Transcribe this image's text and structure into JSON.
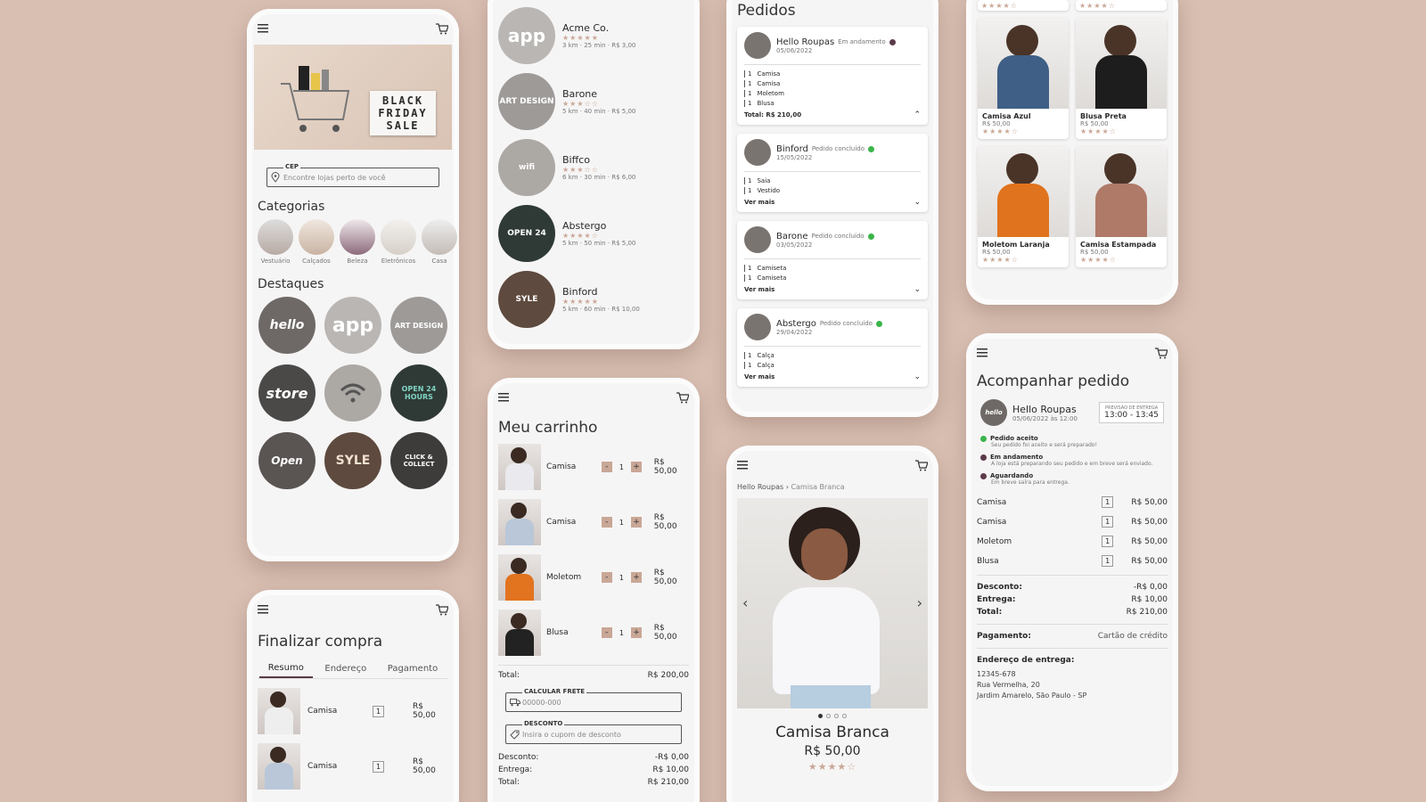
{
  "home": {
    "banner_text": "BLACK FRIDAY SALE",
    "cep_label": "CEP",
    "cep_placeholder": "Encontre lojas perto de você",
    "categories_title": "Categorias",
    "categories": [
      {
        "label": "Vestuário"
      },
      {
        "label": "Calçados"
      },
      {
        "label": "Beleza"
      },
      {
        "label": "Eletrônicos"
      },
      {
        "label": "Casa"
      }
    ],
    "highlights_title": "Destaques",
    "highlights": [
      "hello",
      "app",
      "ART DESIGN",
      "store",
      "wifi",
      "OPEN 24 HOURS",
      "Open",
      "SYLE",
      "CLICK & COLLECT"
    ]
  },
  "stores": [
    {
      "name": "Acme Co.",
      "info": "3 km · 25 min · R$ 3,00",
      "logo": "app",
      "stars": "★★★★★"
    },
    {
      "name": "Barone",
      "info": "5 km · 40 min · R$ 5,00",
      "logo": "ART DESIGN",
      "stars": "★★★☆☆"
    },
    {
      "name": "Biffco",
      "info": "6 km · 30 min · R$ 6,00",
      "logo": "wifi",
      "stars": "★★★☆☆"
    },
    {
      "name": "Abstergo",
      "info": "5 km · 50 min · R$ 5,00",
      "logo": "OPEN 24",
      "stars": "★★★★☆"
    },
    {
      "name": "Binford",
      "info": "5 km · 60 min · R$ 10,00",
      "logo": "SYLE",
      "stars": "★★★★★"
    }
  ],
  "orders": {
    "title": "Pedidos",
    "list": [
      {
        "store": "Hello Roupas",
        "status": "Em andamento",
        "date": "05/06/2022",
        "items": [
          "Camisa",
          "Camisa",
          "Moletom",
          "Blusa"
        ],
        "footer": "Total: R$ 210,00",
        "status_color": "#5b3a4a"
      },
      {
        "store": "Binford",
        "status": "Pedido concluído",
        "date": "15/05/2022",
        "items": [
          "Saia",
          "Vestido"
        ],
        "footer": "Ver mais",
        "status_color": "#3bb54a"
      },
      {
        "store": "Barone",
        "status": "Pedido concluído",
        "date": "03/05/2022",
        "items": [
          "Camiseta",
          "Camiseta"
        ],
        "footer": "Ver mais",
        "status_color": "#3bb54a"
      },
      {
        "store": "Abstergo",
        "status": "Pedido concluído",
        "date": "29/04/2022",
        "items": [
          "Calça",
          "Calça"
        ],
        "footer": "Ver mais",
        "status_color": "#3bb54a"
      }
    ]
  },
  "grid": {
    "products": [
      {
        "name": "Camisa Azul",
        "price": "R$ 50,00",
        "stars": "★★★★☆",
        "color": "#3f5f86"
      },
      {
        "name": "Blusa Preta",
        "price": "R$ 50,00",
        "stars": "★★★★☆",
        "color": "#1d1d1d"
      },
      {
        "name": "Moletom Laranja",
        "price": "R$ 50,00",
        "stars": "★★★★☆",
        "color": "#e0731d"
      },
      {
        "name": "Camisa Estampada",
        "price": "R$ 50,00",
        "stars": "★★★★☆",
        "color": "#b07a68"
      }
    ]
  },
  "cart": {
    "title": "Meu carrinho",
    "items": [
      {
        "name": "Camisa",
        "qty": "1",
        "price": "R$ 50,00",
        "color": "#e9e9ee"
      },
      {
        "name": "Camisa",
        "qty": "1",
        "price": "R$ 50,00",
        "color": "#b9c7d8"
      },
      {
        "name": "Moletom",
        "qty": "1",
        "price": "R$ 50,00",
        "color": "#e2731f"
      },
      {
        "name": "Blusa",
        "qty": "1",
        "price": "R$ 50,00",
        "color": "#222"
      }
    ],
    "minus": "-",
    "plus": "+",
    "total_label": "Total:",
    "total_value": "R$ 200,00",
    "frete_label": "CALCULAR FRETE",
    "frete_placeholder": "00000-000",
    "desconto_label": "DESCONTO",
    "desconto_placeholder": "Insira o cupom de desconto",
    "summary": [
      {
        "label": "Desconto:",
        "value": "-R$ 0,00"
      },
      {
        "label": "Entrega:",
        "value": "R$ 10,00"
      },
      {
        "label": "Total:",
        "value": "R$ 210,00"
      }
    ]
  },
  "checkout": {
    "title": "Finalizar compra",
    "tabs": [
      "Resumo",
      "Endereço",
      "Pagamento"
    ],
    "items": [
      {
        "name": "Camisa",
        "qty": "1",
        "price": "R$ 50,00"
      },
      {
        "name": "Camisa",
        "qty": "1",
        "price": "R$ 50,00"
      }
    ]
  },
  "product": {
    "breadcrumb_store": "Hello Roupas",
    "breadcrumb_sep": "›",
    "breadcrumb_item": "Camisa Branca",
    "name": "Camisa Branca",
    "price": "R$ 50,00",
    "stars": "★★★★☆"
  },
  "tracking": {
    "title": "Acompanhar pedido",
    "store": "Hello Roupas",
    "date": "05/06/2022 às 12:00",
    "eta_label": "PREVISÃO DE ENTREGA",
    "eta_value": "13:00 - 13:45",
    "steps": [
      {
        "title": "Pedido aceito",
        "desc": "Seu pedido foi aceito e será preparado!",
        "color": "#3bb54a"
      },
      {
        "title": "Em andamento",
        "desc": "A loja está preparando seu pedido e em breve será enviado.",
        "color": "#5b3a4a"
      },
      {
        "title": "Aguardando",
        "desc": "Em breve saíra para entrega.",
        "color": "#5b3a4a"
      }
    ],
    "items": [
      {
        "name": "Camisa",
        "qty": "1",
        "price": "R$ 50,00"
      },
      {
        "name": "Camisa",
        "qty": "1",
        "price": "R$ 50,00"
      },
      {
        "name": "Moletom",
        "qty": "1",
        "price": "R$ 50,00"
      },
      {
        "name": "Blusa",
        "qty": "1",
        "price": "R$ 50,00"
      }
    ],
    "summary": [
      {
        "label": "Desconto:",
        "value": "-R$ 0,00"
      },
      {
        "label": "Entrega:",
        "value": "R$ 10,00"
      },
      {
        "label": "Total:",
        "value": "R$ 210,00"
      }
    ],
    "payment_label": "Pagamento:",
    "payment_value": "Cartão de crédito",
    "address_label": "Endereço de entrega:",
    "address_lines": [
      "12345-678",
      "Rua Vermelha, 20",
      "Jardim Amarelo, São Paulo - SP"
    ]
  },
  "colors": {
    "accent": "#c9a796",
    "bg": "#d9bfb2",
    "dark": "#5b3a4a",
    "green": "#3bb54a"
  }
}
